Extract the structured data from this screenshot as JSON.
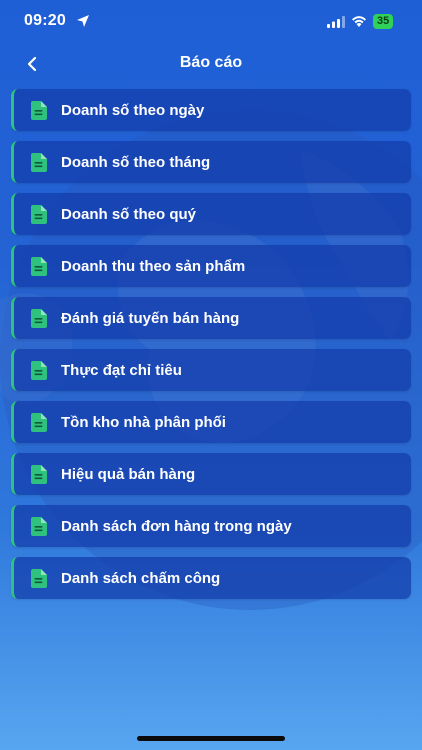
{
  "status_bar": {
    "time": "09:20",
    "battery": "35"
  },
  "header": {
    "title": "Báo cáo"
  },
  "colors": {
    "background_top": "#1f5fd6",
    "background_bottom": "#57a6f0",
    "item_background": "#173fa8",
    "accent_green": "#2ec27e"
  },
  "menu": {
    "items": [
      {
        "label": "Doanh số theo ngày",
        "icon": "document-icon"
      },
      {
        "label": "Doanh số theo tháng",
        "icon": "document-icon"
      },
      {
        "label": "Doanh số theo quý",
        "icon": "document-icon"
      },
      {
        "label": "Doanh thu theo sản phẩm",
        "icon": "document-icon"
      },
      {
        "label": "Đánh giá tuyến bán hàng",
        "icon": "document-icon"
      },
      {
        "label": "Thực đạt chỉ tiêu",
        "icon": "document-icon"
      },
      {
        "label": "Tồn kho nhà phân phối",
        "icon": "document-icon"
      },
      {
        "label": "Hiệu quả bán hàng",
        "icon": "document-icon"
      },
      {
        "label": "Danh sách đơn hàng trong ngày",
        "icon": "document-icon"
      },
      {
        "label": "Danh sách chấm công",
        "icon": "document-icon"
      }
    ]
  }
}
